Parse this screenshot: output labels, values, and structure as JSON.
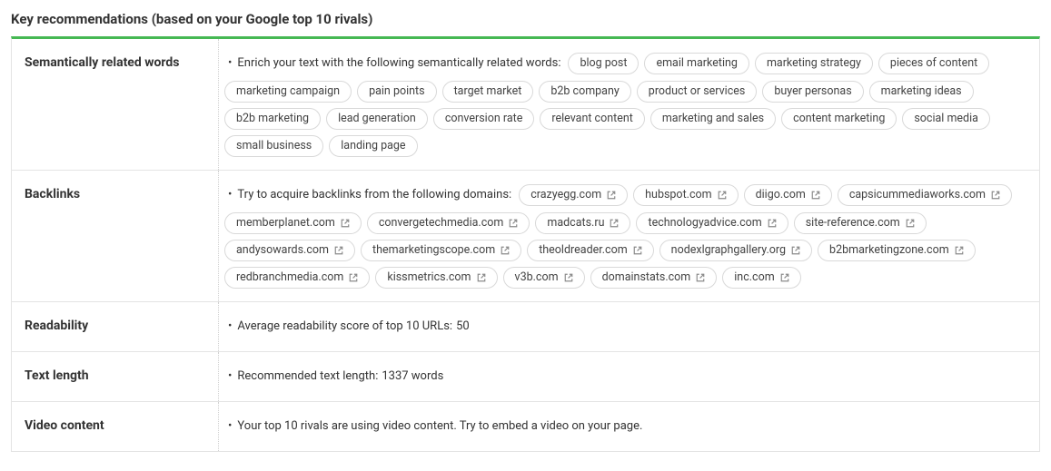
{
  "heading": "Key recommendations (based on your Google top 10 rivals)",
  "sections": {
    "semantic": {
      "label": "Semantically related words",
      "lead": "Enrich your text with the following semantically related words:",
      "tags": [
        "blog post",
        "email marketing",
        "marketing strategy",
        "pieces of content",
        "marketing campaign",
        "pain points",
        "target market",
        "b2b company",
        "product or services",
        "buyer personas",
        "marketing ideas",
        "b2b marketing",
        "lead generation",
        "conversion rate",
        "relevant content",
        "marketing and sales",
        "content marketing",
        "social media",
        "small business",
        "landing page"
      ]
    },
    "backlinks": {
      "label": "Backlinks",
      "lead": "Try to acquire backlinks from the following domains:",
      "domains": [
        "crazyegg.com",
        "hubspot.com",
        "diigo.com",
        "capsicummediaworks.com",
        "memberplanet.com",
        "convergetechmedia.com",
        "madcats.ru",
        "technologyadvice.com",
        "site-reference.com",
        "andysowards.com",
        "themarketingscope.com",
        "theoldreader.com",
        "nodexlgraphgallery.org",
        "b2bmarketingzone.com",
        "redbranchmedia.com",
        "kissmetrics.com",
        "v3b.com",
        "domainstats.com",
        "inc.com"
      ]
    },
    "readability": {
      "label": "Readability",
      "text": "Average readability score of top 10 URLs:",
      "value": "50"
    },
    "textlength": {
      "label": "Text length",
      "text": "Recommended text length:",
      "value": "1337 words"
    },
    "video": {
      "label": "Video content",
      "text": "Your top 10 rivals are using video content. Try to embed a video on your page."
    }
  }
}
